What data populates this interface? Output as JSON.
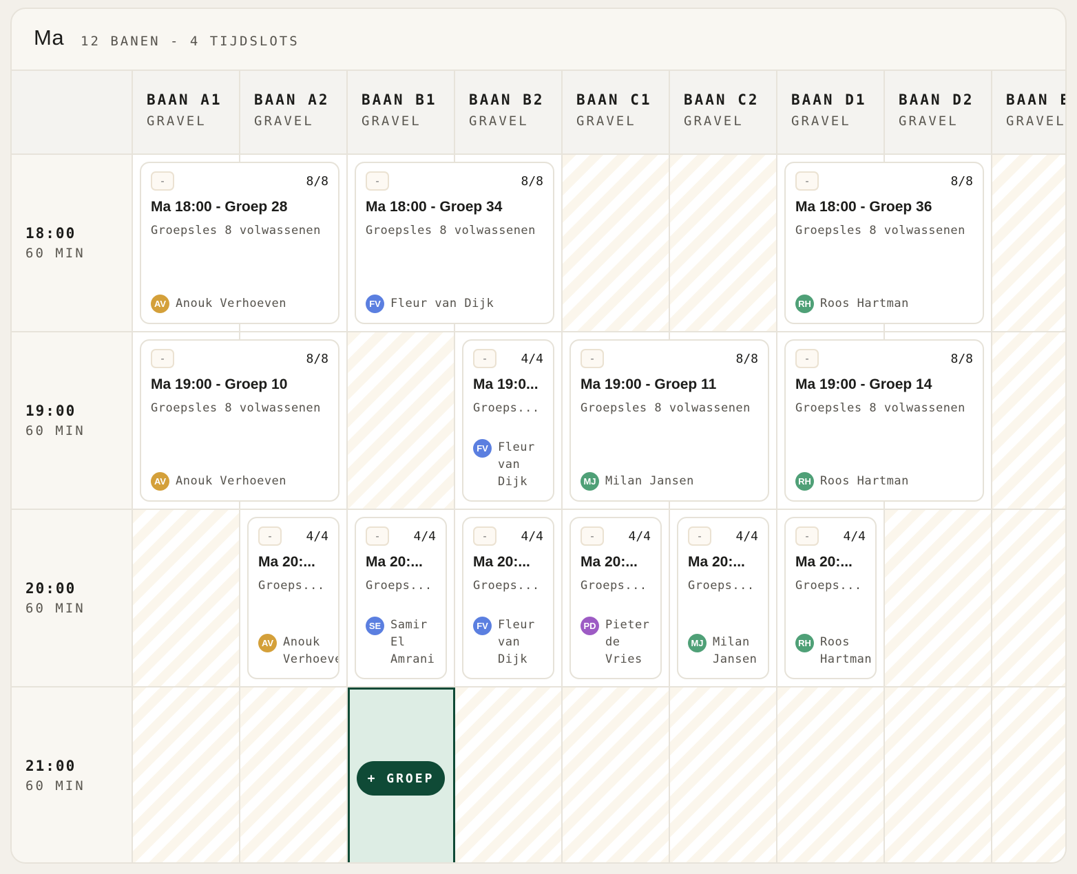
{
  "header": {
    "day": "Ma",
    "summary": "12 BANEN - 4 TIJDSLOTS"
  },
  "courts": [
    {
      "name": "BAAN A1",
      "surface": "GRAVEL"
    },
    {
      "name": "BAAN A2",
      "surface": "GRAVEL"
    },
    {
      "name": "BAAN B1",
      "surface": "GRAVEL"
    },
    {
      "name": "BAAN B2",
      "surface": "GRAVEL"
    },
    {
      "name": "BAAN C1",
      "surface": "GRAVEL"
    },
    {
      "name": "BAAN C2",
      "surface": "GRAVEL"
    },
    {
      "name": "BAAN D1",
      "surface": "GRAVEL"
    },
    {
      "name": "BAAN D2",
      "surface": "GRAVEL"
    },
    {
      "name": "BAAN E",
      "surface": "GRAVEL"
    }
  ],
  "timeslots": [
    {
      "time": "18:00",
      "duration": "60 MIN"
    },
    {
      "time": "19:00",
      "duration": "60 MIN"
    },
    {
      "time": "20:00",
      "duration": "60 MIN"
    },
    {
      "time": "21:00",
      "duration": "60 MIN"
    }
  ],
  "avatar_colors": {
    "AV": "#d4a03a",
    "FV": "#5b7fe0",
    "RH": "#4fa077",
    "MJ": "#4fa077",
    "SE": "#5b7fe0",
    "PD": "#9d5bc4"
  },
  "sessions": [
    {
      "title": "Ma 18:00 - Groep 28",
      "subtitle": "Groepsles 8 volwassenen",
      "count": "8/8",
      "minus": "-",
      "coach": "Anouk Verhoeven",
      "initials": "AV"
    },
    {
      "title": "Ma 18:00 - Groep 34",
      "subtitle": "Groepsles 8 volwassenen",
      "count": "8/8",
      "minus": "-",
      "coach": "Fleur van Dijk",
      "initials": "FV"
    },
    {
      "title": "Ma 18:00 - Groep 36",
      "subtitle": "Groepsles 8 volwassenen",
      "count": "8/8",
      "minus": "-",
      "coach": "Roos Hartman",
      "initials": "RH"
    },
    {
      "title": "Ma 19:00 - Groep 10",
      "subtitle": "Groepsles 8 volwassenen",
      "count": "8/8",
      "minus": "-",
      "coach": "Anouk Verhoeven",
      "initials": "AV"
    },
    {
      "title": "Ma 19:0...",
      "subtitle": "Groeps...",
      "count": "4/4",
      "minus": "-",
      "coach": "Fleur van Dijk",
      "initials": "FV"
    },
    {
      "title": "Ma 19:00 - Groep 11",
      "subtitle": "Groepsles 8 volwassenen",
      "count": "8/8",
      "minus": "-",
      "coach": "Milan Jansen",
      "initials": "MJ"
    },
    {
      "title": "Ma 19:00 - Groep 14",
      "subtitle": "Groepsles 8 volwassenen",
      "count": "8/8",
      "minus": "-",
      "coach": "Roos Hartman",
      "initials": "RH"
    },
    {
      "title": "Ma 20:...",
      "subtitle": "Groeps...",
      "count": "4/4",
      "minus": "-",
      "coach": "Anouk Verhoeven",
      "initials": "AV"
    },
    {
      "title": "Ma 20:...",
      "subtitle": "Groeps...",
      "count": "4/4",
      "minus": "-",
      "coach": "Samir El Amrani",
      "initials": "SE"
    },
    {
      "title": "Ma 20:...",
      "subtitle": "Groeps...",
      "count": "4/4",
      "minus": "-",
      "coach": "Fleur van Dijk",
      "initials": "FV"
    },
    {
      "title": "Ma 20:...",
      "subtitle": "Groeps...",
      "count": "4/4",
      "minus": "-",
      "coach": "Pieter de Vries",
      "initials": "PD"
    },
    {
      "title": "Ma 20:...",
      "subtitle": "Groeps...",
      "count": "4/4",
      "minus": "-",
      "coach": "Milan Jansen",
      "initials": "MJ"
    },
    {
      "title": "Ma 20:...",
      "subtitle": "Groeps...",
      "count": "4/4",
      "minus": "-",
      "coach": "Roos Hartman",
      "initials": "RH"
    }
  ],
  "add_group_label": "+ GROEP"
}
